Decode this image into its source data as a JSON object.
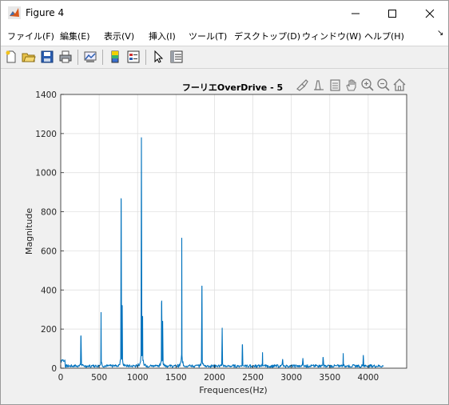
{
  "window": {
    "title": "Figure 4",
    "buttons": [
      "minimize",
      "maximize",
      "close"
    ]
  },
  "menu": {
    "items": [
      {
        "label": "ファイル(F)"
      },
      {
        "label": "編集(E)"
      },
      {
        "label": "表示(V)"
      },
      {
        "label": "挿入(I)"
      },
      {
        "label": "ツール(T)"
      },
      {
        "label": "デスクトップ(D)"
      },
      {
        "label": "ウィンドウ(W)"
      },
      {
        "label": "ヘルプ(H)"
      }
    ],
    "overflow": "↘"
  },
  "toolbar": {
    "icons": [
      "new-figure-icon",
      "open-file-icon",
      "save-icon",
      "print-icon",
      "link-plot-icon",
      "colorbar-icon",
      "legend-icon",
      "pointer-icon",
      "property-inspector-icon"
    ]
  },
  "axes_toolbar": {
    "icons": [
      "brush-icon",
      "data-tips-icon",
      "export-icon",
      "pan-icon",
      "zoom-in-icon",
      "zoom-out-icon",
      "home-icon"
    ]
  },
  "chart_data": {
    "type": "line",
    "title": "フーリエOverDrive - 5",
    "xlabel": "Frequences(Hz)",
    "ylabel": "Magnitude",
    "xlim": [
      0,
      4500
    ],
    "ylim": [
      0,
      1400
    ],
    "xticks": [
      0,
      500,
      1000,
      1500,
      2000,
      2500,
      3000,
      3500,
      4000
    ],
    "yticks": [
      0,
      200,
      400,
      600,
      800,
      1000,
      1200,
      1400
    ],
    "grid": true,
    "color": "#0072bd",
    "peaks": [
      {
        "x": 262,
        "y": 165
      },
      {
        "x": 525,
        "y": 285
      },
      {
        "x": 787,
        "y": 860
      },
      {
        "x": 800,
        "y": 320
      },
      {
        "x": 1050,
        "y": 1175
      },
      {
        "x": 1065,
        "y": 265
      },
      {
        "x": 1312,
        "y": 335
      },
      {
        "x": 1325,
        "y": 240
      },
      {
        "x": 1575,
        "y": 665
      },
      {
        "x": 1837,
        "y": 420
      },
      {
        "x": 2100,
        "y": 205
      },
      {
        "x": 2362,
        "y": 120
      },
      {
        "x": 2625,
        "y": 80
      },
      {
        "x": 2887,
        "y": 45
      },
      {
        "x": 3150,
        "y": 50
      },
      {
        "x": 3412,
        "y": 55
      },
      {
        "x": 3675,
        "y": 75
      },
      {
        "x": 3937,
        "y": 65
      }
    ],
    "x_end": 4200
  }
}
